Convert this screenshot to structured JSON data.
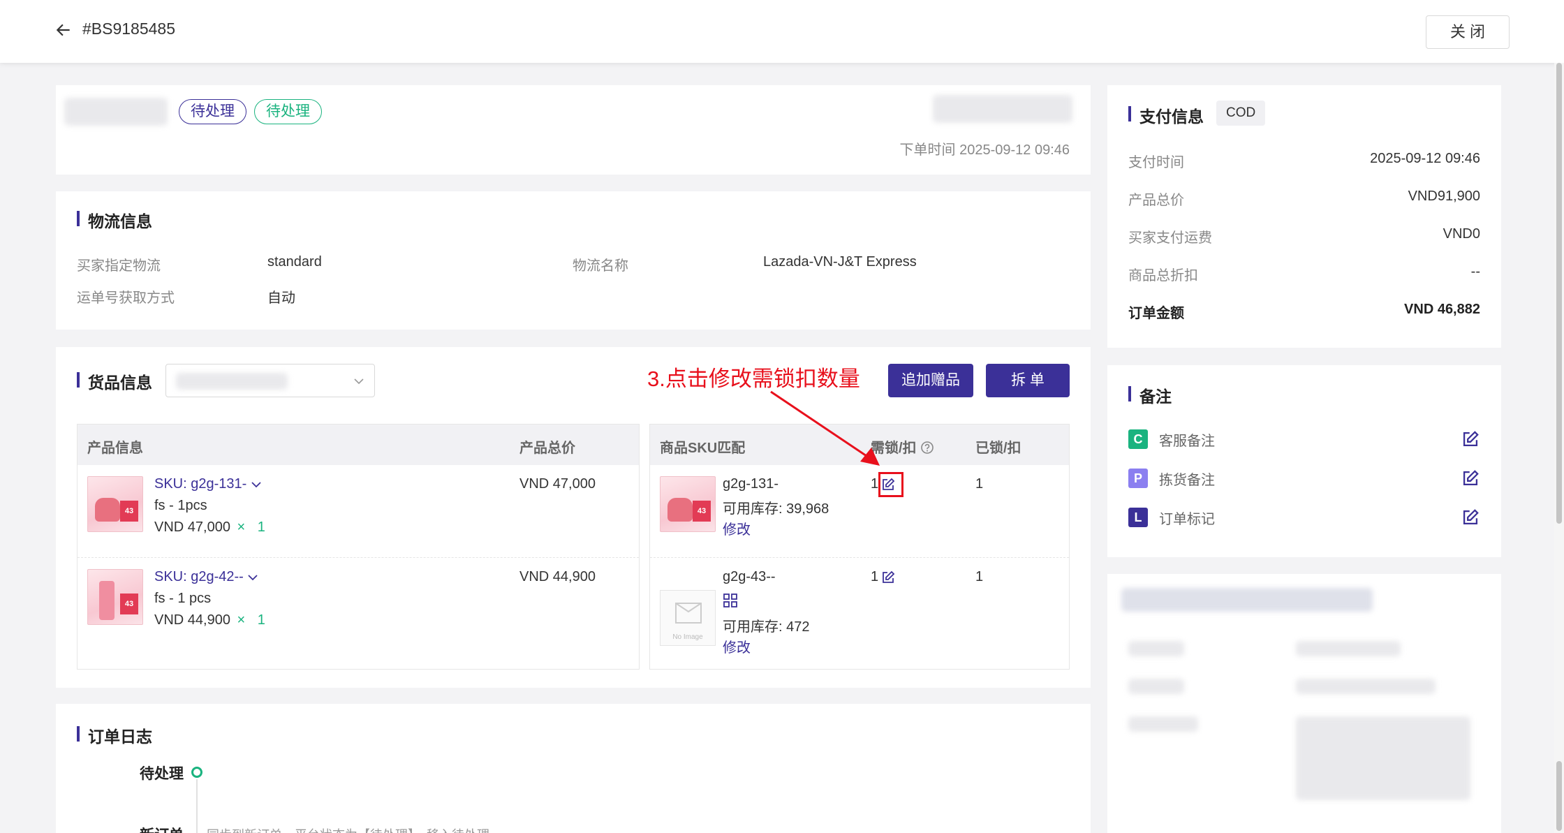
{
  "header": {
    "order_id": "#BS9185485",
    "close_label": "关 闭"
  },
  "summary": {
    "tags": [
      "待处理",
      "待处理"
    ],
    "order_time_label": "下单时间",
    "order_time": "2025-09-12 09:46"
  },
  "logistics": {
    "title": "物流信息",
    "rows": [
      {
        "label": "买家指定物流",
        "value": "standard"
      },
      {
        "label": "运单号获取方式",
        "value": "自动"
      }
    ],
    "name_label": "物流名称",
    "name_value": "Lazada-VN-J&T Express"
  },
  "goods": {
    "title": "货品信息",
    "add_gift_label": "追加赠品",
    "split_label": "拆 单",
    "annotation": "3.点击修改需锁扣数量",
    "left_headers": [
      "产品信息",
      "产品总价"
    ],
    "right_headers": [
      "商品SKU匹配",
      "需锁/扣",
      "已锁/扣"
    ],
    "items": [
      {
        "sku": "SKU: g2g-131-",
        "variant": "fs - 1pcs",
        "price": "VND 47,000",
        "times": "×",
        "qty": "1",
        "total": "VND 47,000",
        "match_sku": "g2g-131-",
        "stock": "可用库存: 39,968",
        "modify": "修改",
        "need_lock": "1",
        "locked": "1"
      },
      {
        "sku": "SKU: g2g-42--",
        "variant": "fs - 1 pcs",
        "price": "VND 44,900",
        "times": "×",
        "qty": "1",
        "total": "VND 44,900",
        "match_sku": "g2g-43--",
        "stock": "可用库存: 472",
        "modify": "修改",
        "need_lock": "1",
        "locked": "1",
        "noimage_text": "No Image"
      }
    ],
    "thumb_badge": "43"
  },
  "order_log": {
    "title": "订单日志",
    "entries": [
      {
        "status": "待处理"
      },
      {
        "status": "新订单",
        "desc": "同步到新订单，平台状态为【待处理】，移入待处理"
      }
    ]
  },
  "payment": {
    "title": "支付信息",
    "method": "COD",
    "rows": [
      {
        "label": "支付时间",
        "value": "2025-09-12 09:46"
      },
      {
        "label": "产品总价",
        "value": "VND91,900"
      },
      {
        "label": "买家支付运费",
        "value": "VND0"
      },
      {
        "label": "商品总折扣",
        "value": "--"
      }
    ],
    "total_label": "订单金额",
    "total_value": "VND 46,882"
  },
  "remarks": {
    "title": "备注",
    "items": [
      {
        "badge": "C",
        "label": "客服备注",
        "color": "#1ab37f"
      },
      {
        "badge": "P",
        "label": "拣货备注",
        "color": "#8b7ff0"
      },
      {
        "badge": "L",
        "label": "订单标记",
        "color": "#3b3098"
      }
    ]
  },
  "colors": {
    "primary": "#3b3098",
    "success": "#1ab37f",
    "annotation": "#e8101c"
  }
}
